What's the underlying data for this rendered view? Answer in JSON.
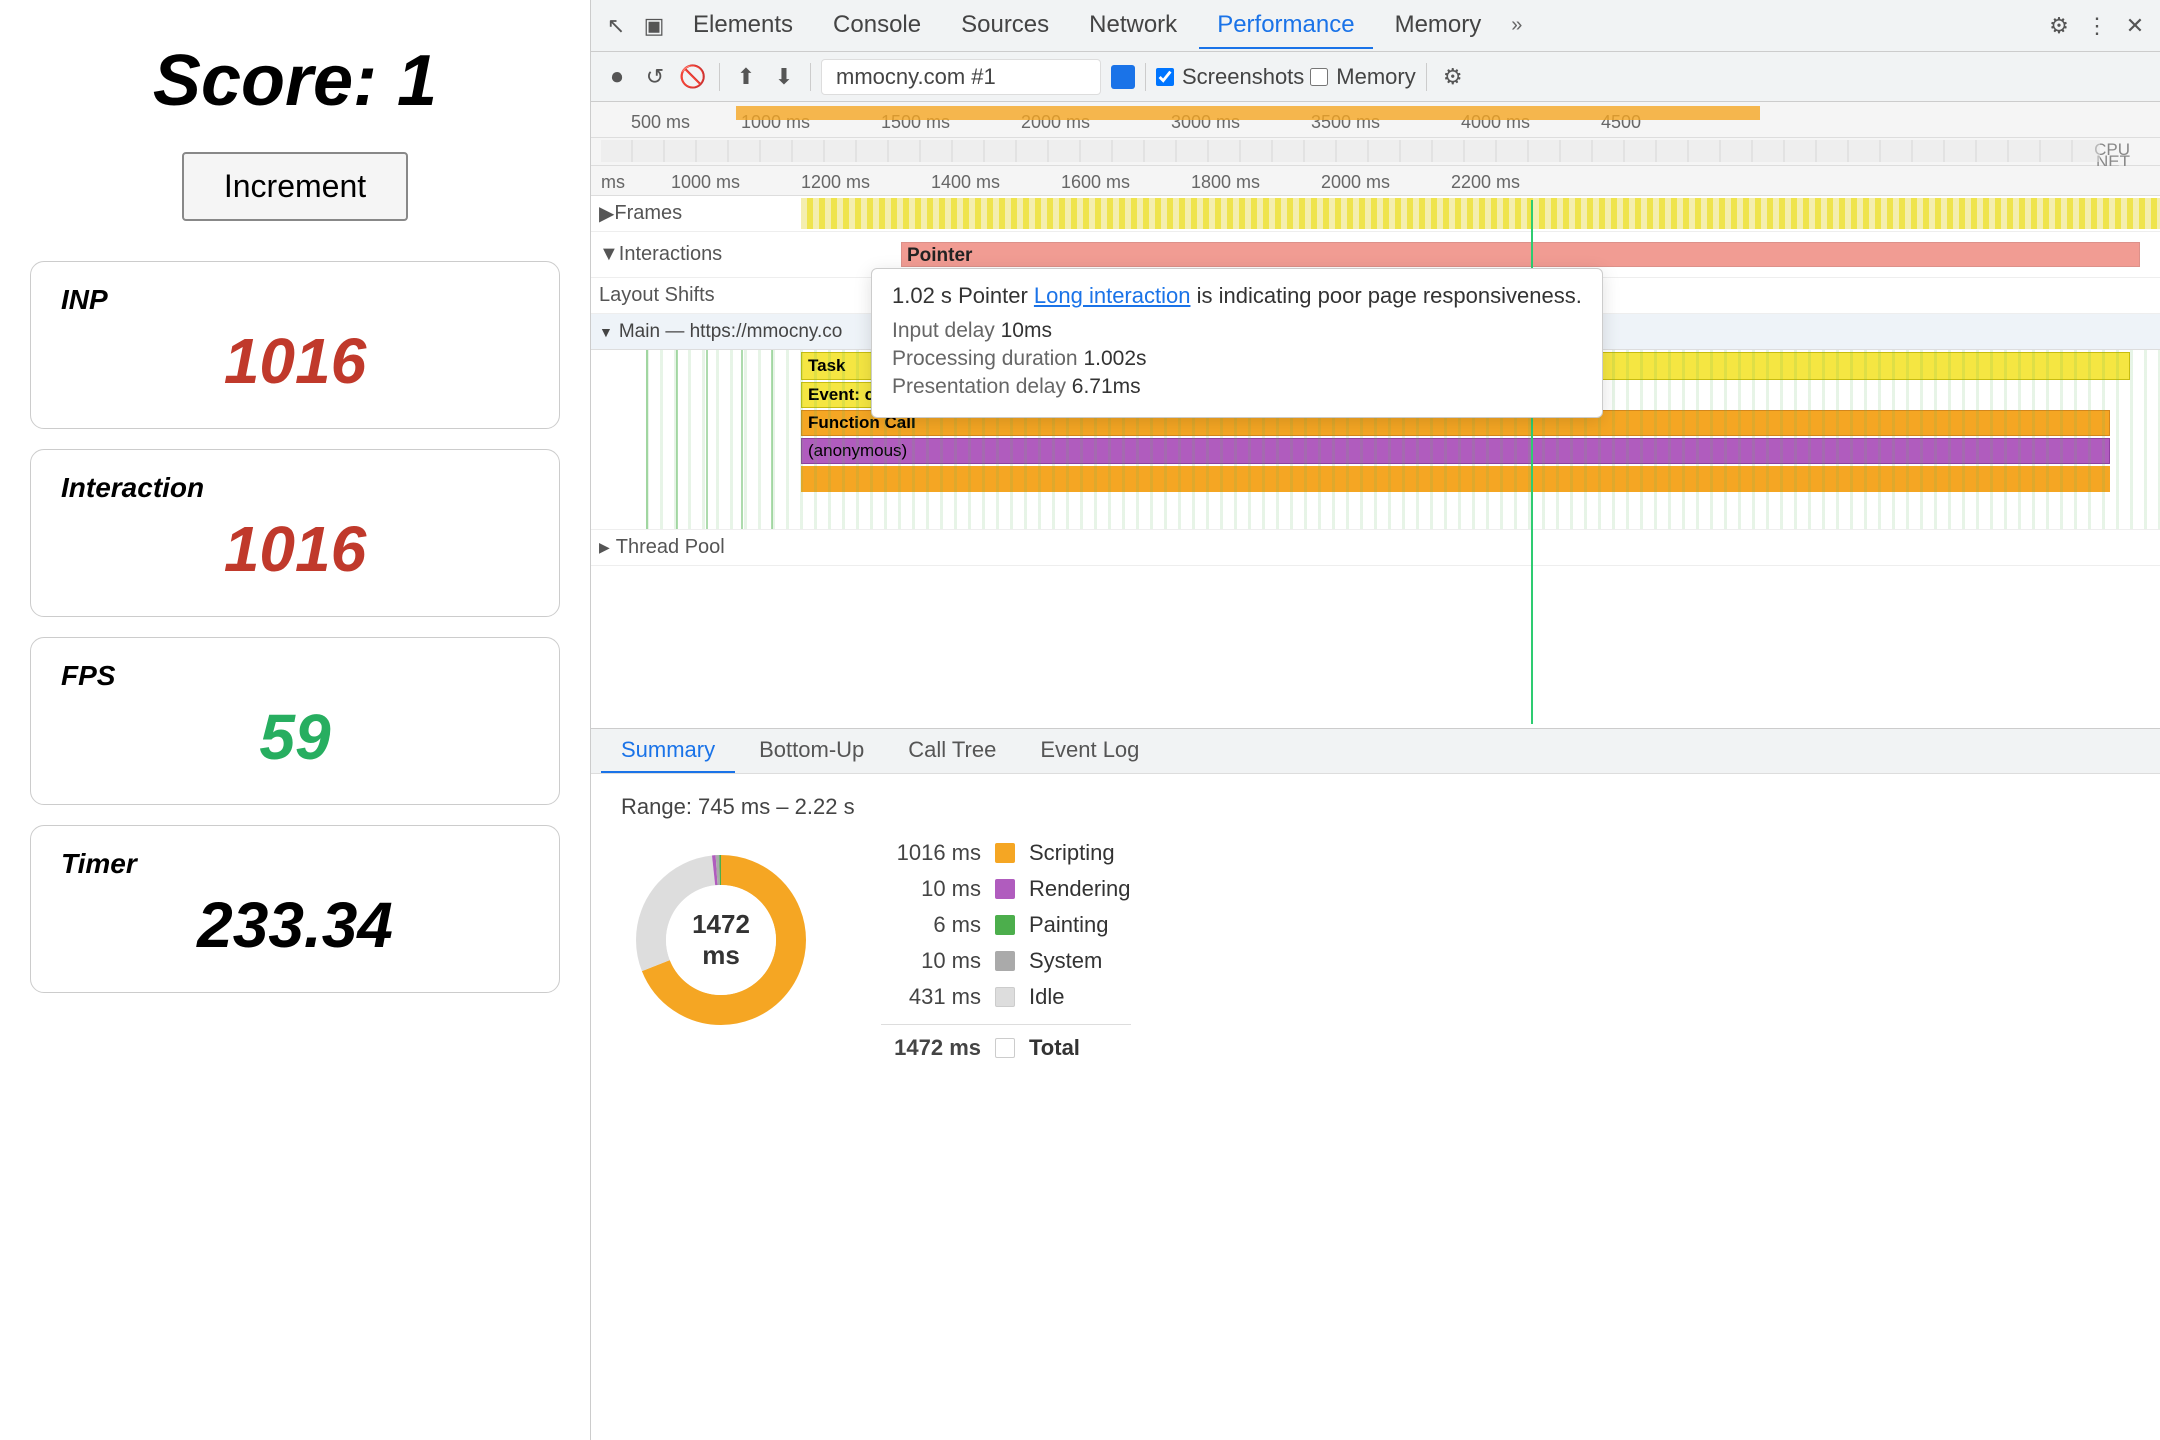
{
  "left": {
    "score_label": "Score: 1",
    "increment_btn": "Increment",
    "metrics": [
      {
        "id": "inp",
        "label": "INP",
        "value": "1016",
        "color": "red"
      },
      {
        "id": "interaction",
        "label": "Interaction",
        "value": "1016",
        "color": "red"
      },
      {
        "id": "fps",
        "label": "FPS",
        "value": "59",
        "color": "green"
      },
      {
        "id": "timer",
        "label": "Timer",
        "value": "233.34",
        "color": "black"
      }
    ]
  },
  "devtools": {
    "tabs": [
      "Elements",
      "Console",
      "Sources",
      "Network",
      "Performance",
      "Memory"
    ],
    "active_tab": "Performance",
    "toolbar": {
      "url": "mmocny.com #1",
      "screenshots_label": "Screenshots",
      "memory_label": "Memory"
    },
    "timeline": {
      "time_labels_top": [
        "500 ms",
        "1000 ms",
        "1500 ms",
        "2000 ms",
        "3000 ms",
        "3500 ms",
        "4000 ms",
        "4500"
      ],
      "time_labels_mid": [
        "ms",
        "1000 ms",
        "1200 ms",
        "1400 ms",
        "1600 ms",
        "1800 ms",
        "2000 ms",
        "2200 ms"
      ],
      "rows": {
        "frames": "Frames",
        "interactions": "Interactions",
        "layout_shifts": "Layout Shifts",
        "main": "Main — https://mmocny.co",
        "task": "Task",
        "event_click": "Event: click",
        "function_call": "Function Call",
        "anonymous": "(anonymous)",
        "thread_pool": "Thread Pool"
      },
      "pointer_label": "Pointer"
    },
    "tooltip": {
      "time": "1.02 s",
      "type": "Pointer",
      "link_text": "Long interaction",
      "suffix": "is indicating poor page responsiveness.",
      "input_delay_label": "Input delay",
      "input_delay_value": "10ms",
      "processing_label": "Processing duration",
      "processing_value": "1.002s",
      "presentation_label": "Presentation delay",
      "presentation_value": "6.71ms"
    },
    "bottom_tabs": [
      "Summary",
      "Bottom-Up",
      "Call Tree",
      "Event Log"
    ],
    "active_bottom_tab": "Summary",
    "summary": {
      "range": "Range: 745 ms – 2.22 s",
      "donut_label": "1472 ms",
      "legend": [
        {
          "ms": "1016 ms",
          "color": "#f5a623",
          "label": "Scripting"
        },
        {
          "ms": "10 ms",
          "color": "#b05cbe",
          "label": "Rendering"
        },
        {
          "ms": "6 ms",
          "color": "#4cae4c",
          "label": "Painting"
        },
        {
          "ms": "10 ms",
          "color": "#aaaaaa",
          "label": "System"
        },
        {
          "ms": "431 ms",
          "color": "#dddddd",
          "label": "Idle"
        }
      ],
      "total_ms": "1472 ms",
      "total_label": "Total"
    }
  },
  "icons": {
    "record": "⏺",
    "reload": "↺",
    "clear": "🚫",
    "upload": "⬆",
    "download": "⬇",
    "settings": "⚙",
    "more": "⋮",
    "close": "✕",
    "cursor": "↖",
    "device": "▣",
    "pencil": "✏",
    "chevron_right": "▶",
    "chevron_down": "▼"
  }
}
